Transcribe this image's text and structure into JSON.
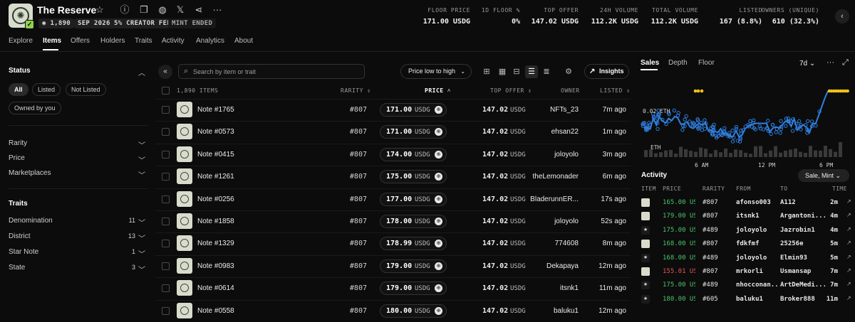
{
  "collection": {
    "title": "The Reserve",
    "chips": [
      "1,890",
      "SEP 2026",
      "5% CREATOR FEE",
      "MINT ENDED"
    ]
  },
  "stats": [
    {
      "label": "FLOOR PRICE",
      "value": "171.00 USDG"
    },
    {
      "label": "1D FLOOR %",
      "value": "0%"
    },
    {
      "label": "TOP OFFER",
      "value": "147.02 USDG"
    },
    {
      "label": "24H VOLUME",
      "value": "112.2K USDG"
    },
    {
      "label": "TOTAL VOLUME",
      "value": "112.2K USDG"
    },
    {
      "label": "LISTED",
      "value": "167 (8.8%)"
    },
    {
      "label": "OWNERS (UNIQUE)",
      "value": "610 (32.3%)"
    }
  ],
  "nav": {
    "tabs": [
      "Explore",
      "Items",
      "Offers",
      "Holders",
      "Traits",
      "Activity",
      "Analytics",
      "About"
    ],
    "active": "Items"
  },
  "sidebar": {
    "status_label": "Status",
    "status_filters": [
      "All",
      "Listed",
      "Not Listed",
      "Owned by you"
    ],
    "sections": [
      "Rarity",
      "Price",
      "Marketplaces"
    ],
    "traits_label": "Traits",
    "traits": [
      {
        "name": "Denomination",
        "count": "11"
      },
      {
        "name": "District",
        "count": "13"
      },
      {
        "name": "Star Note",
        "count": "1"
      },
      {
        "name": "State",
        "count": "3"
      }
    ]
  },
  "toolbar": {
    "search_placeholder": "Search by item or trait",
    "sort_label": "Price low to high",
    "insights_label": "Insights"
  },
  "table": {
    "headers": {
      "items": "1,890 ITEMS",
      "rarity": "RARITY",
      "price": "PRICE",
      "top_offer": "TOP OFFER",
      "owner": "OWNER",
      "listed": "LISTED"
    },
    "rows": [
      {
        "name": "Note #1765",
        "rarity": "#807",
        "price": "171.00",
        "currency": "USDG",
        "top_offer": "147.02",
        "owner": "NFTs_23",
        "listed": "7m ago"
      },
      {
        "name": "Note #0573",
        "rarity": "#807",
        "price": "171.00",
        "currency": "USDG",
        "top_offer": "147.02",
        "owner": "ehsan22",
        "listed": "1m ago"
      },
      {
        "name": "Note #0415",
        "rarity": "#807",
        "price": "174.00",
        "currency": "USDG",
        "top_offer": "147.02",
        "owner": "joloyolo",
        "listed": "3m ago"
      },
      {
        "name": "Note #1261",
        "rarity": "#807",
        "price": "175.00",
        "currency": "USDG",
        "top_offer": "147.02",
        "owner": "theLemonader",
        "listed": "6m ago"
      },
      {
        "name": "Note #0256",
        "rarity": "#807",
        "price": "177.00",
        "currency": "USDG",
        "top_offer": "147.02",
        "owner": "BladerunnER...",
        "listed": "17s ago"
      },
      {
        "name": "Note #1858",
        "rarity": "#807",
        "price": "178.00",
        "currency": "USDG",
        "top_offer": "147.02",
        "owner": "joloyolo",
        "listed": "52s ago"
      },
      {
        "name": "Note #1329",
        "rarity": "#807",
        "price": "178.99",
        "currency": "USDG",
        "top_offer": "147.02",
        "owner": "774608",
        "listed": "8m ago"
      },
      {
        "name": "Note #0983",
        "rarity": "#807",
        "price": "179.00",
        "currency": "USDG",
        "top_offer": "147.02",
        "owner": "Dekapaya",
        "listed": "12m ago"
      },
      {
        "name": "Note #0614",
        "rarity": "#807",
        "price": "179.00",
        "currency": "USDG",
        "top_offer": "147.02",
        "owner": "itsnk1",
        "listed": "11m ago"
      },
      {
        "name": "Note #0558",
        "rarity": "#807",
        "price": "180.00",
        "currency": "USDG",
        "top_offer": "147.02",
        "owner": "baluku1",
        "listed": "12m ago"
      }
    ]
  },
  "right_panel": {
    "tabs": [
      "Sales",
      "Depth",
      "Floor"
    ],
    "active_tab": "Sales",
    "period": "7d",
    "chart": {
      "ytick_top": "0.02 ETH",
      "ytick_bottom": "ETH",
      "xticks": [
        "6 AM",
        "12 PM",
        "6 PM"
      ],
      "line_color": "#2f7fe0",
      "dot_color": "#2f7fe0",
      "highlight_color": "#f2c21b"
    },
    "activity_title": "Activity",
    "activity_filter": "Sale, Mint",
    "activity_headers": [
      "ITEM",
      "PRICE",
      "RARITY",
      "FROM",
      "TO",
      "TIME"
    ],
    "activity": [
      {
        "icon": "note",
        "price": "165.00 USD",
        "rarity": "#807",
        "from": "afonso003",
        "to": "A112",
        "time": "2m",
        "red": false
      },
      {
        "icon": "note",
        "price": "179.00 USD",
        "rarity": "#807",
        "from": "itsnk1",
        "to": "Argantoni...",
        "time": "4m",
        "red": false
      },
      {
        "icon": "star",
        "price": "175.00 USD",
        "rarity": "#489",
        "from": "joloyolo",
        "to": "Jazrobin1",
        "time": "4m",
        "red": false
      },
      {
        "icon": "note",
        "price": "168.00 USD",
        "rarity": "#807",
        "from": "fdkfmf",
        "to": "25256e",
        "time": "5m",
        "red": false
      },
      {
        "icon": "star",
        "price": "168.00 USD",
        "rarity": "#489",
        "from": "joloyolo",
        "to": "Elmin93",
        "time": "5m",
        "red": false
      },
      {
        "icon": "note",
        "price": "155.01 USD",
        "rarity": "#807",
        "from": "mrkorli",
        "to": "Usmansap",
        "time": "7m",
        "red": true
      },
      {
        "icon": "star",
        "price": "175.00 USD",
        "rarity": "#489",
        "from": "nhocconan...",
        "to": "ArtDeMedi...",
        "time": "7m",
        "red": false
      },
      {
        "icon": "star",
        "price": "180.00 USD",
        "rarity": "#605",
        "from": "baluku1",
        "to": "Broker888",
        "time": "11m",
        "red": false
      }
    ]
  }
}
